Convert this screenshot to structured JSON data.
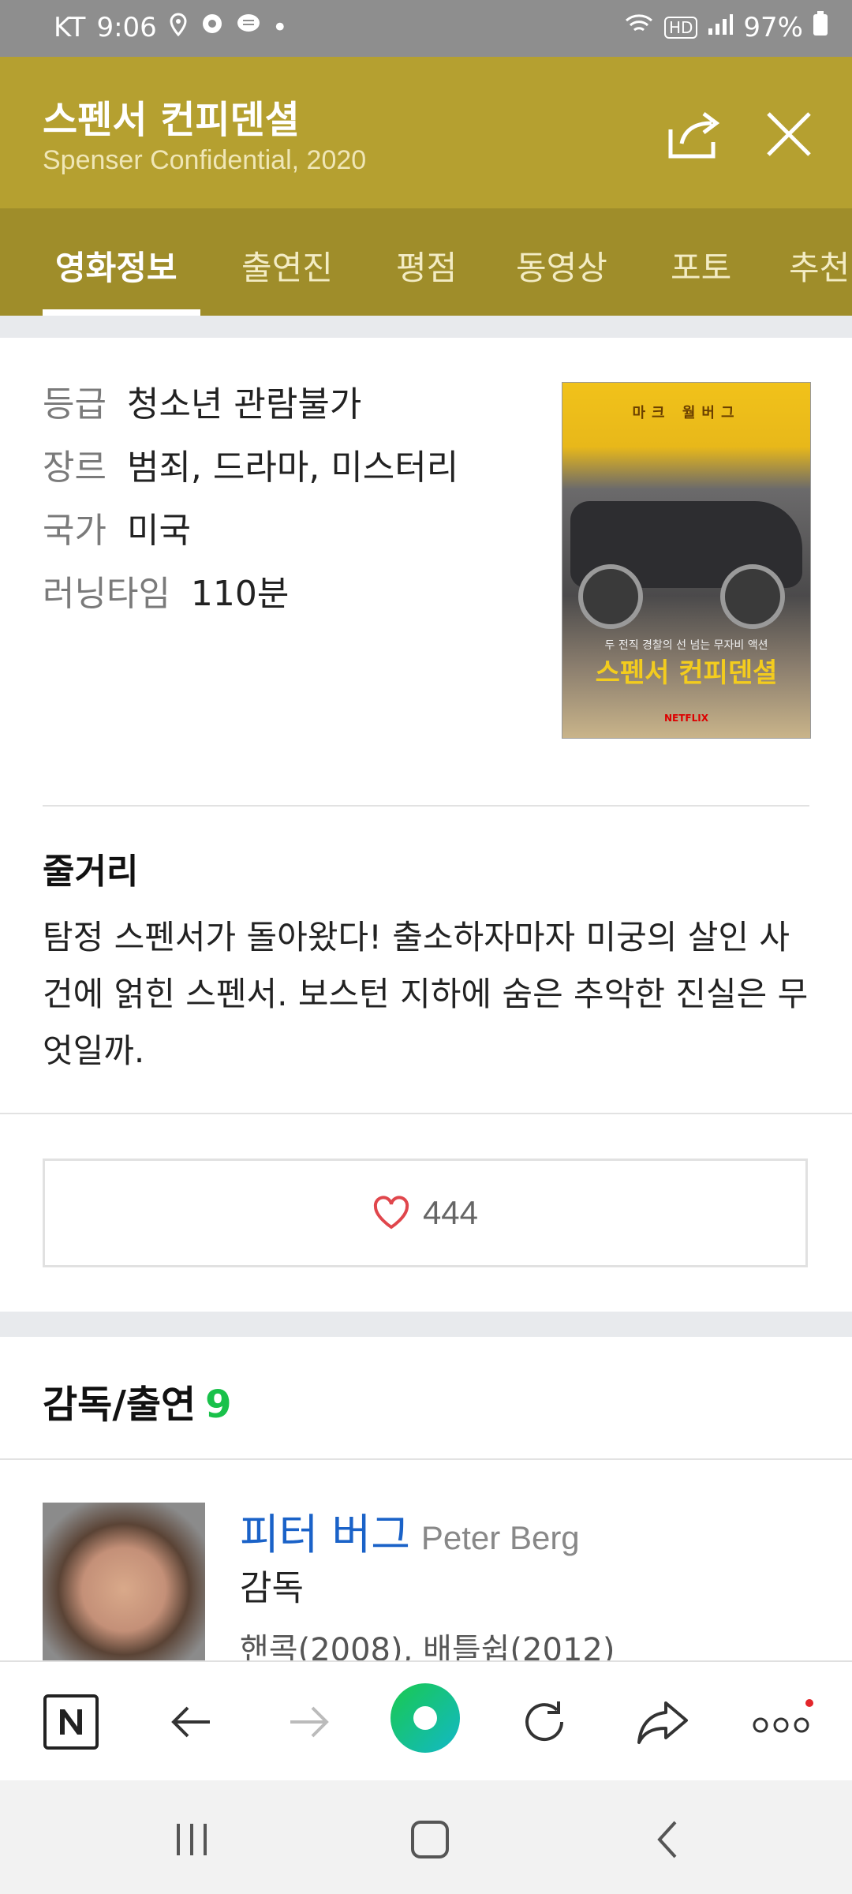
{
  "status_bar": {
    "carrier": "KT",
    "time": "9:06",
    "network": "HD",
    "battery": "97%"
  },
  "header": {
    "title": "스펜서 컨피덴셜",
    "subtitle": "Spenser Confidential, 2020"
  },
  "tabs": [
    {
      "label": "영화정보",
      "active": true
    },
    {
      "label": "출연진"
    },
    {
      "label": "평점"
    },
    {
      "label": "동영상"
    },
    {
      "label": "포토"
    },
    {
      "label": "추천"
    }
  ],
  "info": {
    "rows": [
      {
        "label": "등급",
        "value": "청소년 관람불가"
      },
      {
        "label": "장르",
        "value": "범죄, 드라마, 미스터리"
      },
      {
        "label": "국가",
        "value": "미국"
      },
      {
        "label": "러닝타임",
        "value": "110분"
      }
    ]
  },
  "poster": {
    "top_text": "마크 월버그",
    "title": "스펜서 컨피덴셜",
    "tagline": "두 전직 경찰의 선 넘는 무자비 액션",
    "logo": "NETFLIX"
  },
  "synopsis": {
    "heading": "줄거리",
    "text": "탐정 스펜서가 돌아왔다! 출소하자마자 미궁의 살인 사건에 얽힌 스펜서. 보스턴 지하에 숨은 추악한 진실은 무엇일까."
  },
  "like": {
    "count": "444"
  },
  "cast_section": {
    "title": "감독/출연",
    "count": "9",
    "first_person": {
      "name_ko": "피터 버그",
      "name_en": "Peter Berg",
      "role": "감독",
      "works": "핸콕(2008), 배틀쉽(2012)"
    }
  },
  "colors": {
    "header_bg": "#b5a030",
    "tabs_bg": "#9f8d2a",
    "accent_green": "#19c14a",
    "link_blue": "#1a62c8"
  },
  "browser_bar_icons": [
    "naver-home-icon",
    "back-arrow-icon",
    "forward-arrow-icon",
    "green-dot-icon",
    "refresh-icon",
    "share-icon",
    "more-icon"
  ],
  "nav_bar_icons": [
    "recent-apps-icon",
    "home-icon",
    "back-icon"
  ]
}
